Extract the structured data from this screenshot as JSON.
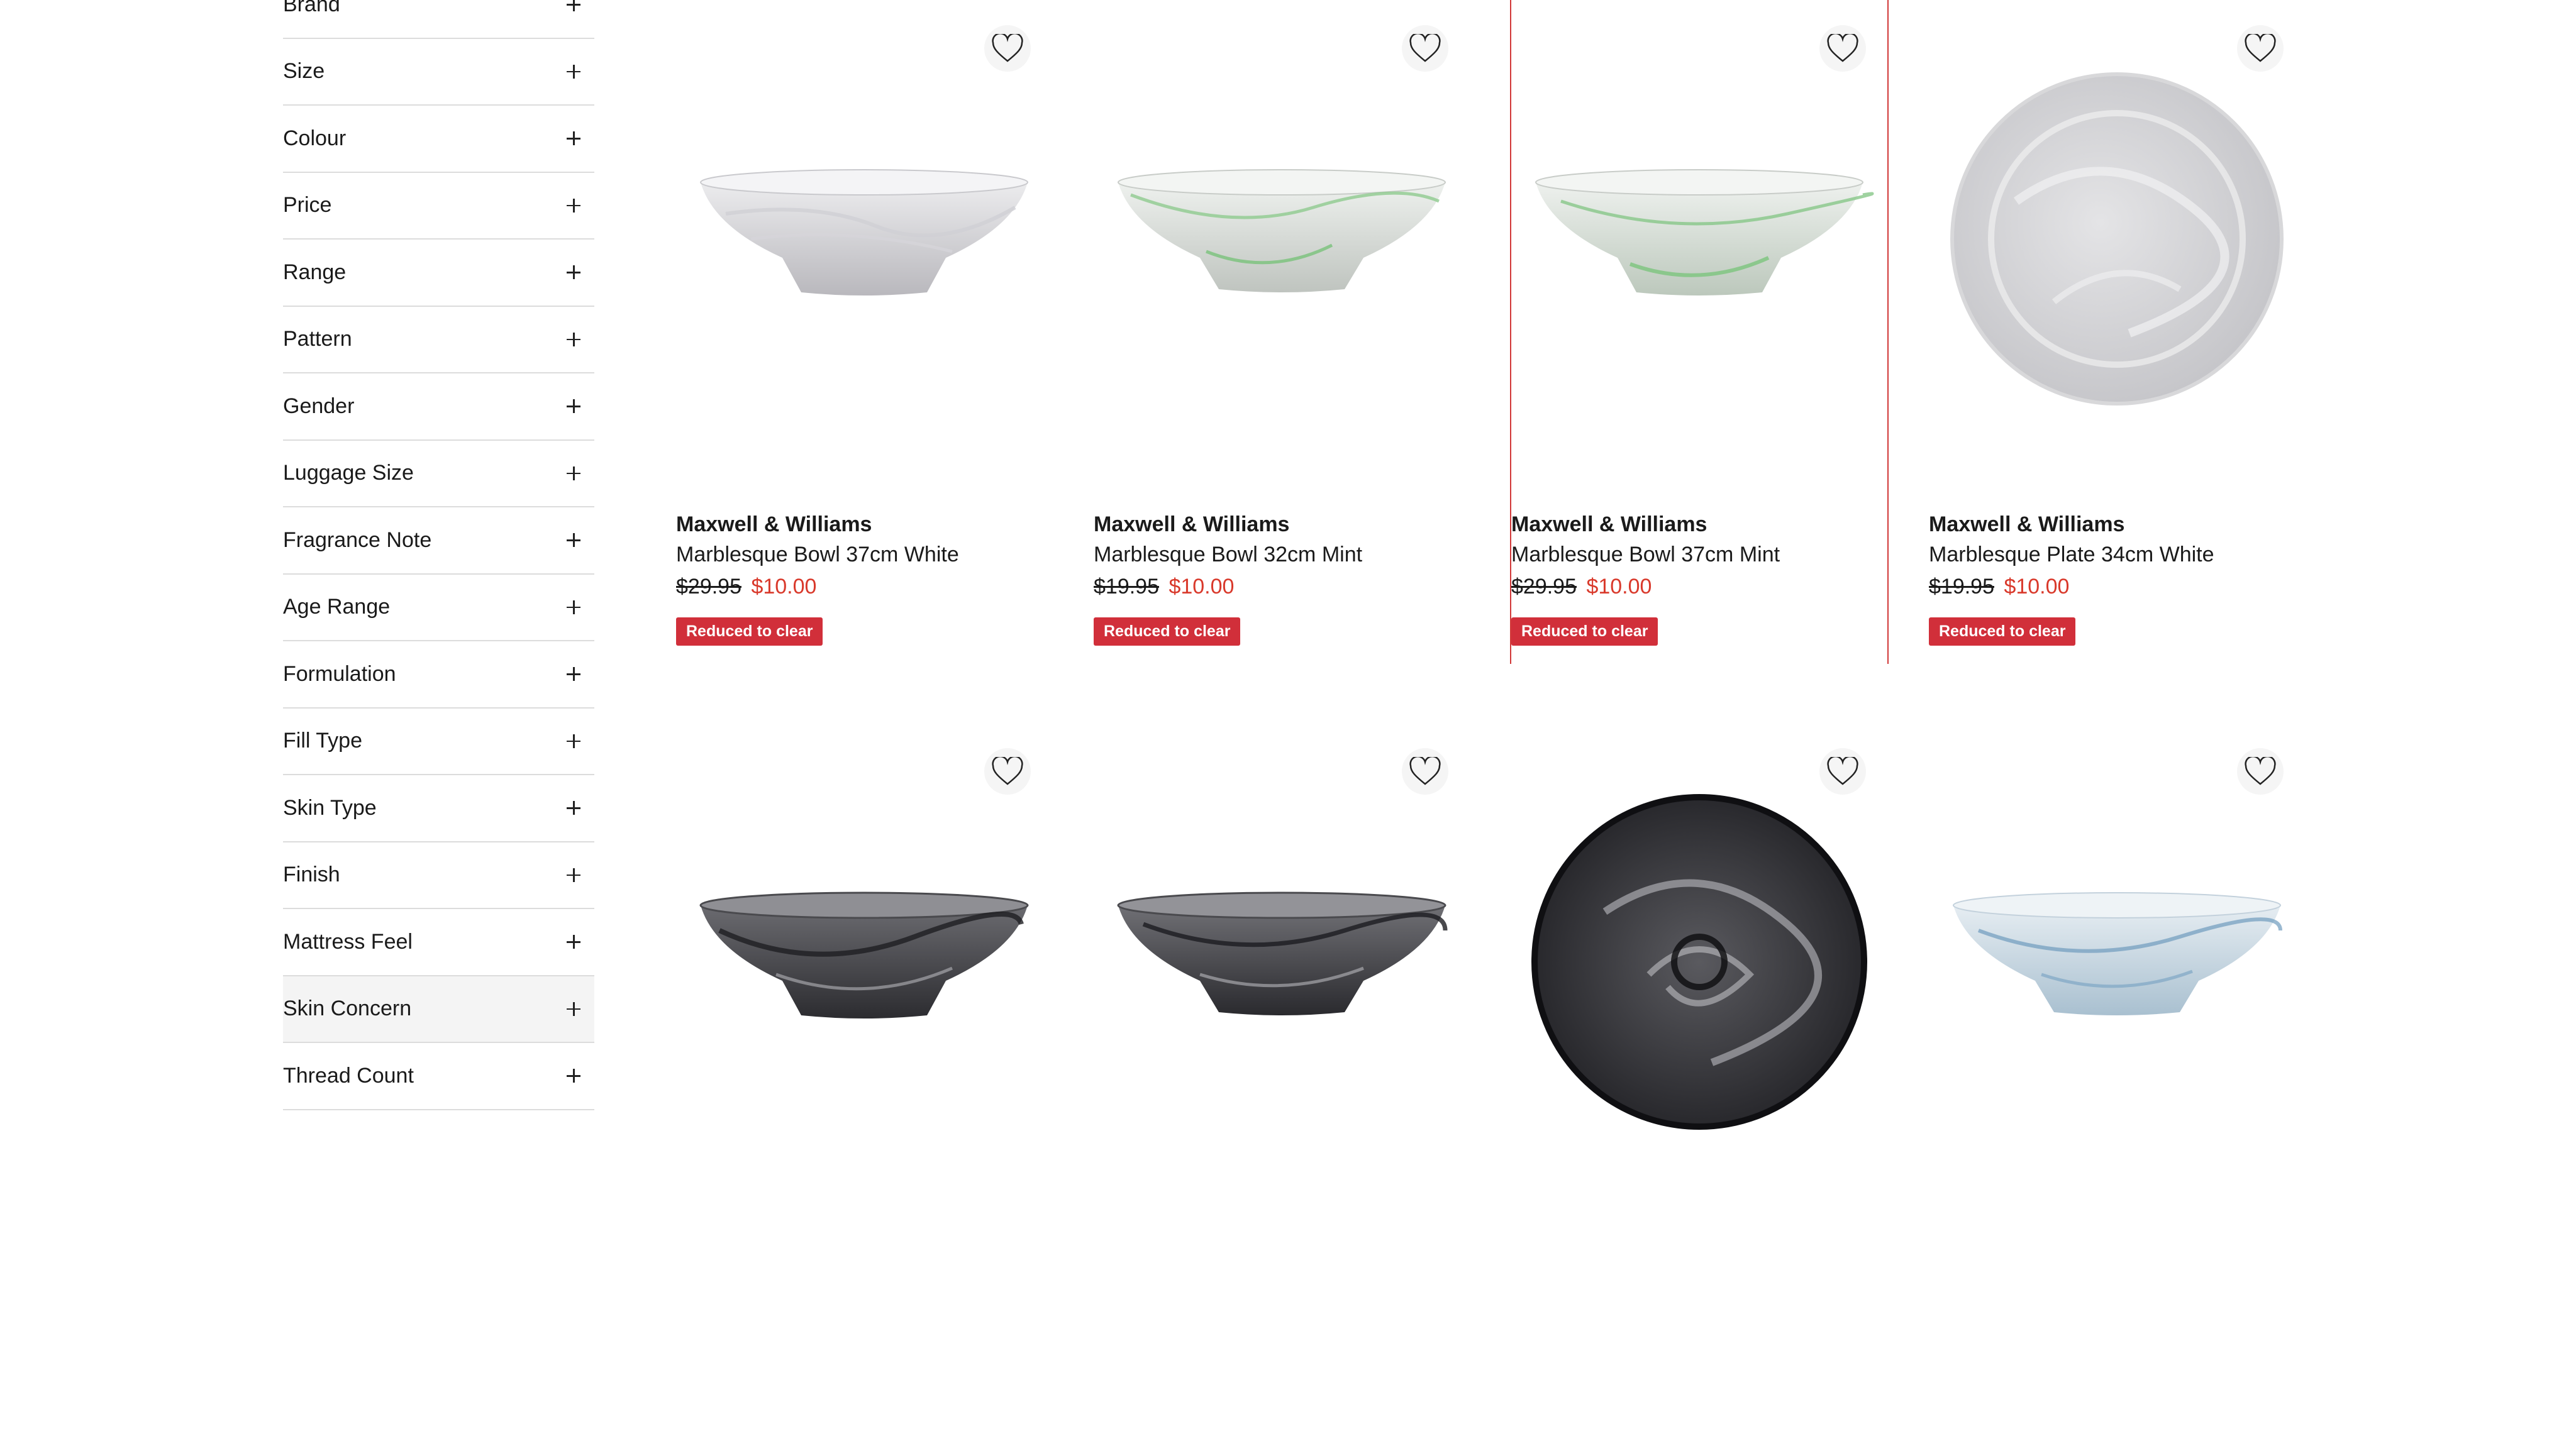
{
  "filters": [
    {
      "label": "Brand"
    },
    {
      "label": "Size"
    },
    {
      "label": "Colour"
    },
    {
      "label": "Price"
    },
    {
      "label": "Range"
    },
    {
      "label": "Pattern"
    },
    {
      "label": "Gender"
    },
    {
      "label": "Luggage Size"
    },
    {
      "label": "Fragrance Note"
    },
    {
      "label": "Age Range"
    },
    {
      "label": "Formulation"
    },
    {
      "label": "Fill Type"
    },
    {
      "label": "Skin Type"
    },
    {
      "label": "Finish"
    },
    {
      "label": "Mattress Feel"
    },
    {
      "label": "Skin Concern"
    },
    {
      "label": "Thread Count"
    }
  ],
  "products": [
    {
      "brand": "Maxwell & Williams",
      "name": "Marblesque Bowl 37cm White",
      "old_price": "$29.95",
      "new_price": "$10.00",
      "badge": "Reduced to clear",
      "image": "white-marble-bowl"
    },
    {
      "brand": "Maxwell & Williams",
      "name": "Marblesque Bowl 32cm Mint",
      "old_price": "$19.95",
      "new_price": "$10.00",
      "badge": "Reduced to clear",
      "image": "mint-marble-bowl"
    },
    {
      "brand": "Maxwell & Williams",
      "name": "Marblesque Bowl 37cm Mint",
      "old_price": "$29.95",
      "new_price": "$10.00",
      "badge": "Reduced to clear",
      "image": "mint-marble-bowl"
    },
    {
      "brand": "Maxwell & Williams",
      "name": "Marblesque Plate 34cm White",
      "old_price": "$19.95",
      "new_price": "$10.00",
      "badge": "Reduced to clear",
      "image": "white-marble-plate"
    },
    {
      "image": "black-marble-bowl"
    },
    {
      "image": "black-marble-bowl"
    },
    {
      "image": "black-marble-plate"
    },
    {
      "image": "blue-marble-bowl"
    }
  ],
  "icons": {
    "wishlist": "heart-outline-icon",
    "expand": "plus-icon"
  },
  "colors": {
    "sale_price": "#d9392b",
    "badge_bg": "#d12f3a",
    "focus_outline": "#d13939"
  }
}
